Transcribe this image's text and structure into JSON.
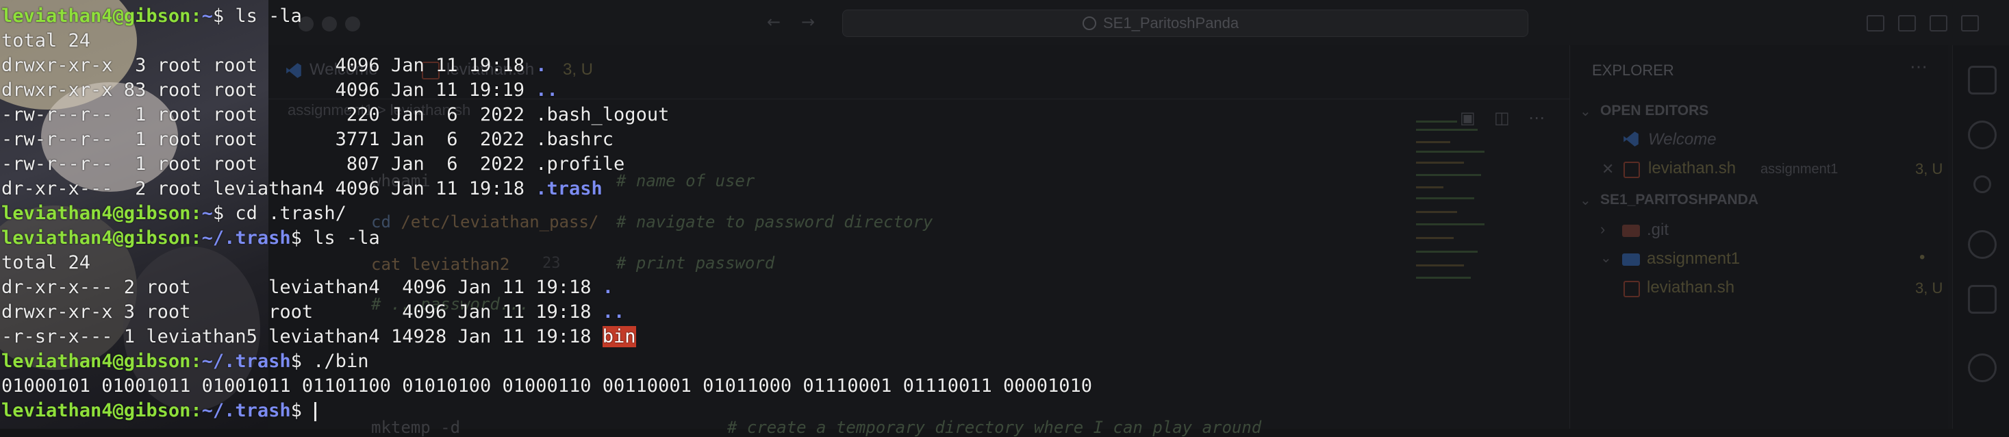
{
  "colors": {
    "prompt_user": "#8fe03b",
    "prompt_path": "#7c8cf2",
    "directory": "#7c8cf2",
    "exec_highlight_bg": "#c33b28",
    "terminal_text": "#ededed",
    "background": "#141517"
  },
  "vscode": {
    "search_label": "SE1_ParitoshPanda",
    "tabs": [
      {
        "label": "Welcome"
      },
      {
        "label": "leviathan.sh",
        "badge": "3, U"
      }
    ],
    "breadcrumb": "assignment1 > leviathan.sh",
    "code": [
      {
        "text": "whoami",
        "comment": "# name of user"
      },
      {
        "keyword": "cd",
        "text": " /etc/leviathan_pass/",
        "comment": "# navigate to password directory"
      },
      {
        "text": "",
        "comment": "# print password"
      },
      {
        "keyword": "cat",
        "text": " leviathan2",
        "comment": ""
      },
      {
        "text": "# ...password...",
        "comment": ""
      },
      {
        "text": "mktemp -d",
        "comment": "# create a temporary directory where I can play around"
      }
    ],
    "line_number": "23",
    "explorer": {
      "title": "EXPLORER",
      "open_editors_header": "OPEN EDITORS",
      "open_editors": [
        {
          "label": "Welcome",
          "detail": ""
        },
        {
          "label": "leviathan.sh",
          "detail": "assignment1",
          "badge": "3, U"
        }
      ],
      "project_header": "SE1_PARITOSHPANDA",
      "tree": [
        {
          "label": ".git",
          "badge": ""
        },
        {
          "label": "assignment1",
          "badge": "•"
        },
        {
          "label": "leviathan.sh",
          "badge": "3, U"
        }
      ]
    }
  },
  "terminal": {
    "user_host": "leviathan4@gibson",
    "lines": [
      {
        "kind": "prompt",
        "path": "~",
        "cmd": "ls -la"
      },
      {
        "kind": "out",
        "text": "total 24"
      },
      {
        "kind": "ls",
        "text": "drwxr-xr-x  3 root root       4096 Jan 11 19:18 ",
        "name": ".",
        "style": "dir"
      },
      {
        "kind": "ls",
        "text": "drwxr-xr-x 83 root root       4096 Jan 11 19:19 ",
        "name": "..",
        "style": "dir"
      },
      {
        "kind": "ls",
        "text": "-rw-r--r--  1 root root        220 Jan  6  2022 ",
        "name": ".bash_logout",
        "style": "plain"
      },
      {
        "kind": "ls",
        "text": "-rw-r--r--  1 root root       3771 Jan  6  2022 ",
        "name": ".bashrc",
        "style": "plain"
      },
      {
        "kind": "ls",
        "text": "-rw-r--r--  1 root root        807 Jan  6  2022 ",
        "name": ".profile",
        "style": "plain"
      },
      {
        "kind": "ls",
        "text": "dr-xr-x---  2 root leviathan4 4096 Jan 11 19:18 ",
        "name": ".trash",
        "style": "dir"
      },
      {
        "kind": "prompt",
        "path": "~",
        "cmd": "cd .trash/"
      },
      {
        "kind": "prompt",
        "path": "~/.trash",
        "cmd": "ls -la"
      },
      {
        "kind": "out",
        "text": "total 24"
      },
      {
        "kind": "ls",
        "text": "dr-xr-x--- 2 root       leviathan4  4096 Jan 11 19:18 ",
        "name": ".",
        "style": "dir"
      },
      {
        "kind": "ls",
        "text": "drwxr-xr-x 3 root       root        4096 Jan 11 19:18 ",
        "name": "..",
        "style": "dir"
      },
      {
        "kind": "ls",
        "text": "-r-sr-x--- 1 leviathan5 leviathan4 14928 Jan 11 19:18 ",
        "name": "bin",
        "style": "exec"
      },
      {
        "kind": "prompt",
        "path": "~/.trash",
        "cmd": "./bin"
      },
      {
        "kind": "out",
        "text": "01000101 01001011 01001011 01101100 01010100 01000110 00110001 01011000 01110001 01110011 00001010"
      },
      {
        "kind": "prompt",
        "path": "~/.trash",
        "cmd": "",
        "cursor": true
      }
    ]
  }
}
